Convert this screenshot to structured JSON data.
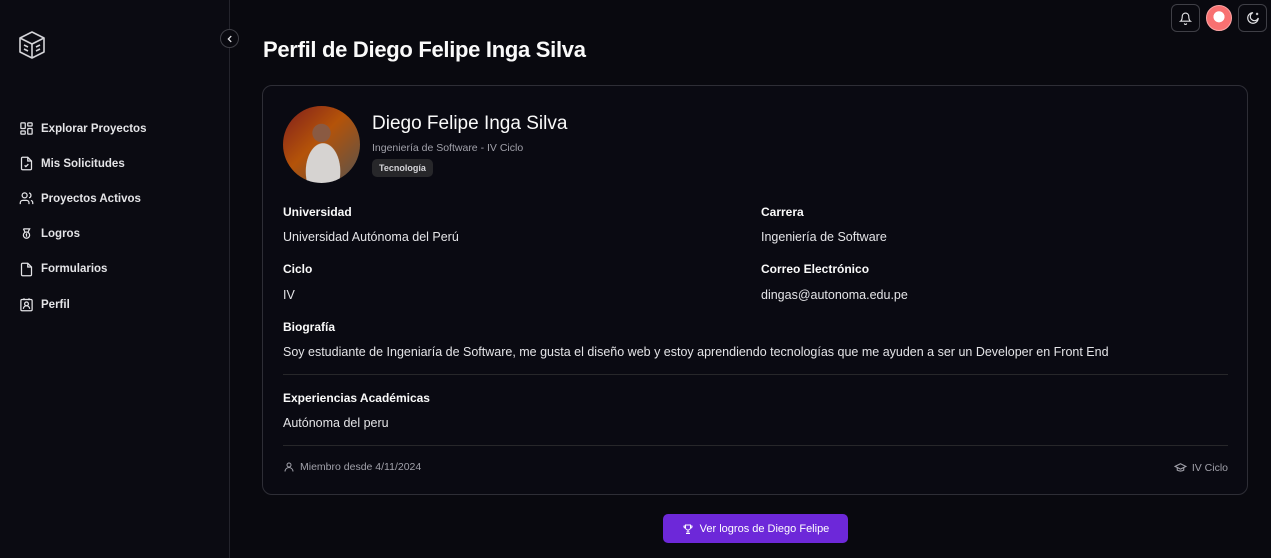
{
  "sidebar": {
    "items": [
      {
        "label": "Explorar Proyectos",
        "icon": "grid-icon"
      },
      {
        "label": "Mis Solicitudes",
        "icon": "file-check-icon"
      },
      {
        "label": "Proyectos Activos",
        "icon": "users-icon"
      },
      {
        "label": "Logros",
        "icon": "award-icon"
      },
      {
        "label": "Formularios",
        "icon": "file-icon"
      },
      {
        "label": "Perfil",
        "icon": "contact-icon"
      }
    ]
  },
  "page": {
    "title": "Perfil de Diego Felipe Inga Silva"
  },
  "profile": {
    "name": "Diego Felipe Inga Silva",
    "subtitle": "Ingeniería de Software - IV Ciclo",
    "tag": "Tecnología"
  },
  "fields": {
    "universidad_label": "Universidad",
    "universidad_value": "Universidad Autónoma del Perú",
    "carrera_label": "Carrera",
    "carrera_value": "Ingeniería de Software",
    "ciclo_label": "Ciclo",
    "ciclo_value": "IV",
    "correo_label": "Correo Electrónico",
    "correo_value": "dingas@autonoma.edu.pe",
    "biografia_label": "Biografía",
    "biografia_value": "Soy estudiante de Ingeniaría de Software, me gusta el diseño web y estoy aprendiendo tecnologías que me ayuden a ser un Developer en Front End",
    "experiencias_label": "Experiencias Académicas",
    "experiencias_value": "Autónoma del peru"
  },
  "footer": {
    "member_since": "Miembro desde 4/11/2024",
    "cycle": "IV Ciclo"
  },
  "cta": {
    "label": "Ver logros de Diego Felipe"
  },
  "colors": {
    "accent": "#6d28d9",
    "background": "#09090f"
  }
}
